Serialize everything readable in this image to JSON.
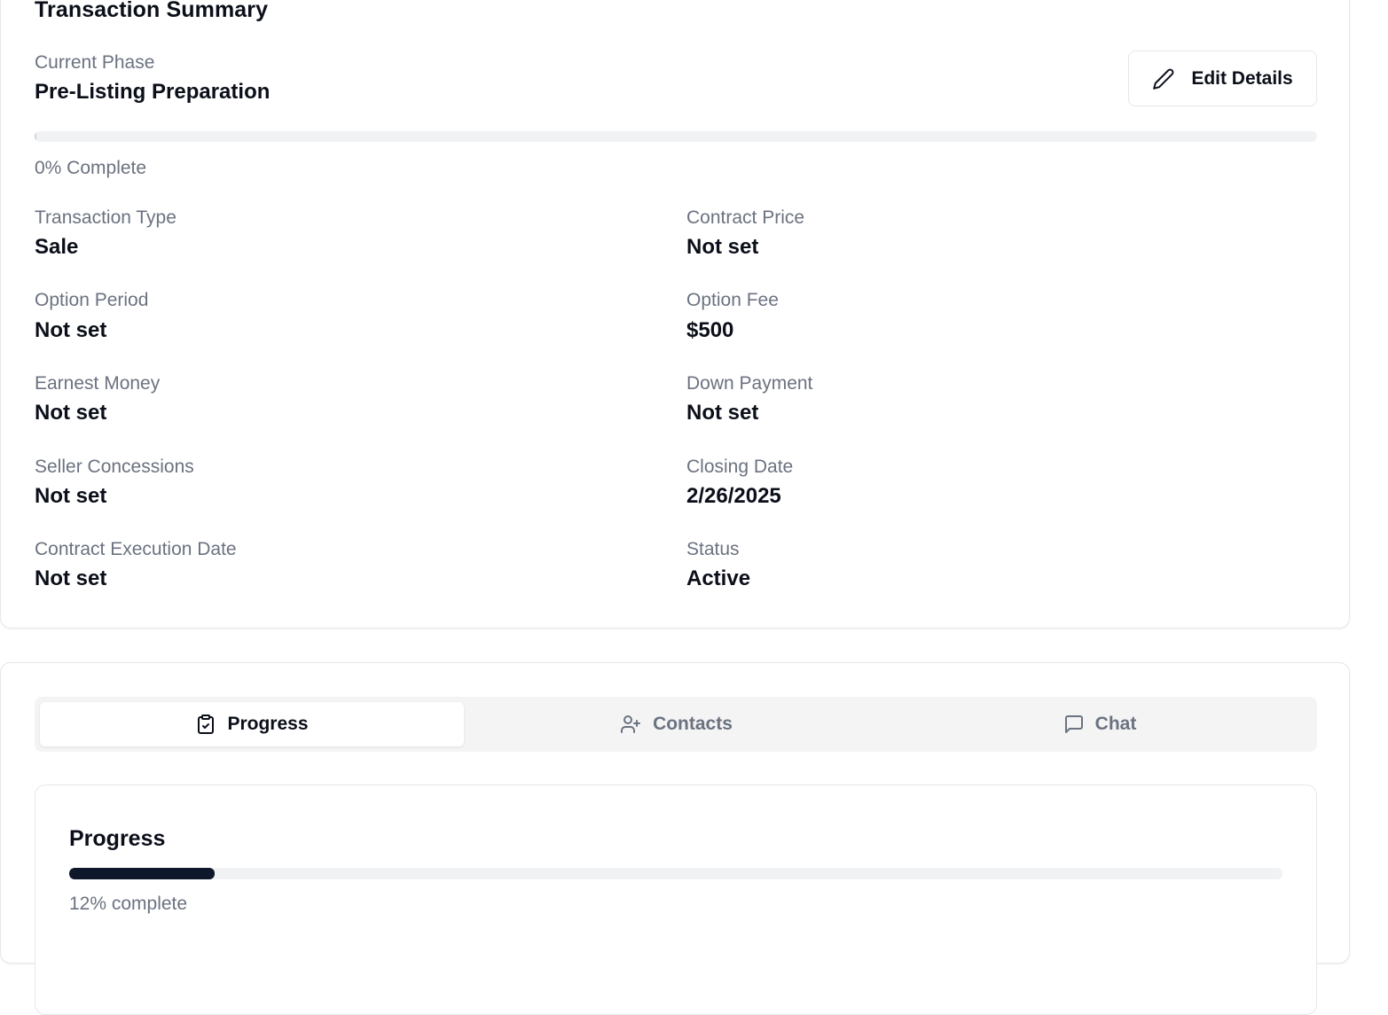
{
  "summary": {
    "title": "Transaction Summary",
    "phase_label": "Current Phase",
    "phase_value": "Pre-Listing Preparation",
    "edit_label": "Edit Details",
    "phase_progress_percent": 0,
    "phase_progress_text": "0% Complete",
    "fields": {
      "transaction_type": {
        "label": "Transaction Type",
        "value": "Sale"
      },
      "contract_price": {
        "label": "Contract Price",
        "value": "Not set"
      },
      "option_period": {
        "label": "Option Period",
        "value": "Not set"
      },
      "option_fee": {
        "label": "Option Fee",
        "value": "$500"
      },
      "earnest_money": {
        "label": "Earnest Money",
        "value": "Not set"
      },
      "down_payment": {
        "label": "Down Payment",
        "value": "Not set"
      },
      "seller_concessions": {
        "label": "Seller Concessions",
        "value": "Not set"
      },
      "closing_date": {
        "label": "Closing Date",
        "value": "2/26/2025"
      },
      "contract_execution_date": {
        "label": "Contract Execution Date",
        "value": "Not set"
      },
      "status": {
        "label": "Status",
        "value": "Active"
      }
    }
  },
  "tabs": {
    "progress": {
      "label": "Progress",
      "icon": "clipboard-check-icon"
    },
    "contacts": {
      "label": "Contacts",
      "icon": "user-plus-icon"
    },
    "chat": {
      "label": "Chat",
      "icon": "message-square-icon"
    }
  },
  "progress_panel": {
    "title": "Progress",
    "percent": 12,
    "text": "12% complete"
  },
  "colors": {
    "accent": "#0f172a",
    "muted_text": "#6b7280",
    "track": "#f1f2f3"
  }
}
